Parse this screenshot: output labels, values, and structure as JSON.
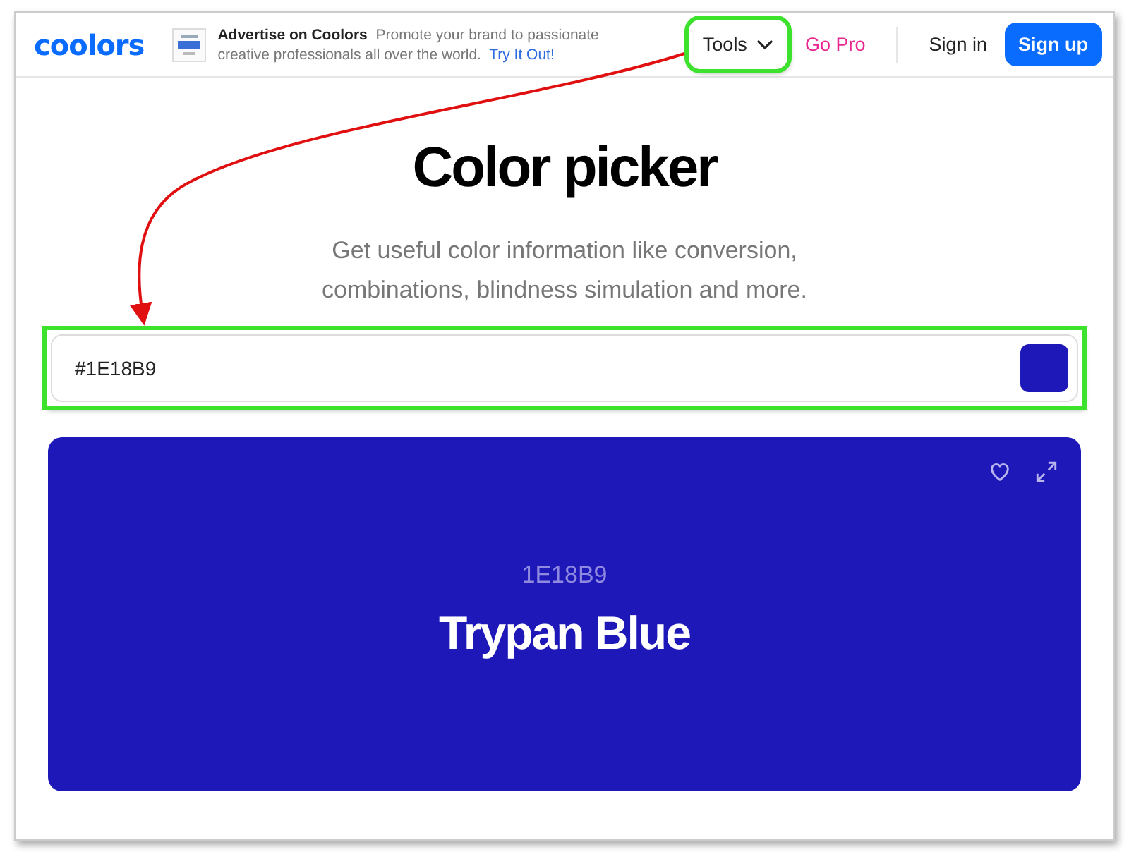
{
  "header": {
    "logo": "coolors",
    "ad": {
      "kind": "picture",
      "title": "Advertise on Coolors",
      "text": "Promote your brand to passionate creative professionals all over the world.",
      "link": "Try It Out!"
    },
    "nav": [
      {
        "label": "Tools",
        "kind": "dropdown",
        "highlighted": true
      },
      {
        "label": "Go Pro",
        "kind": "pro",
        "highlighted": false
      },
      {
        "label": "Sign in",
        "kind": "link",
        "highlighted": false
      },
      {
        "label": "Sign up",
        "kind": "primary",
        "highlighted": false
      }
    ]
  },
  "title": "Color picker",
  "subtitle": "Get useful color information like conversion, combinations, blindness simulation and more.",
  "input": {
    "value": "#1E18B9",
    "highlighted": true
  },
  "card": {
    "hex": "1E18B9",
    "name": "Trypan Blue"
  },
  "annotation": {
    "arrow": true
  }
}
